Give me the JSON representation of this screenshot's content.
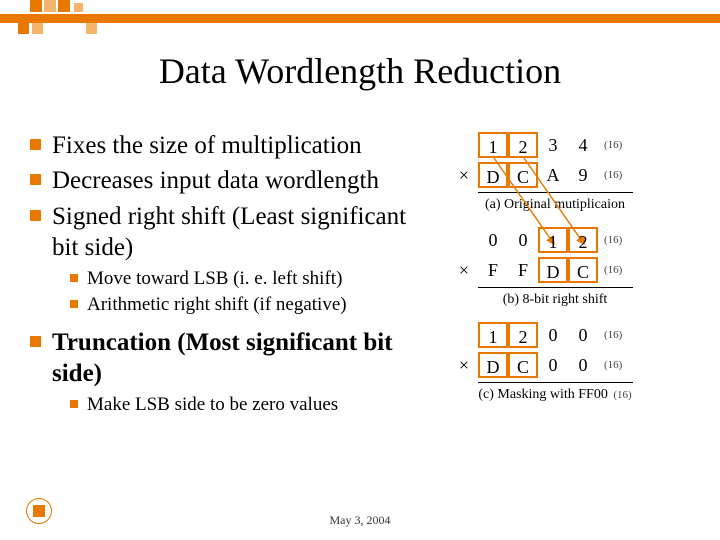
{
  "title": "Data Wordlength Reduction",
  "bullets": {
    "b1": "Fixes the size of multiplication",
    "b2": "Decreases input data wordlength",
    "b3": "Signed right shift (Least significant bit side)",
    "b3_sub": {
      "a": "Move toward LSB (i. e. left shift)",
      "b": "Arithmetic right shift (if negative)"
    },
    "b4": "Truncation (Most significant bit side)",
    "b4_sub": {
      "a": "Make LSB side to be zero values"
    }
  },
  "diagram": {
    "r1": {
      "a": "1",
      "b": "2",
      "c": "3",
      "d": "4",
      "sub": "(16)"
    },
    "r2": {
      "a": "D",
      "b": "C",
      "c": "A",
      "d": "9",
      "sub": "(16)"
    },
    "cap_a": "(a) Original mutiplicaion",
    "r3": {
      "a": "0",
      "b": "0",
      "c": "1",
      "d": "2",
      "sub": "(16)"
    },
    "r4": {
      "a": "F",
      "b": "F",
      "c": "D",
      "d": "C",
      "sub": "(16)"
    },
    "cap_b": "(b) 8-bit right shift",
    "r5": {
      "a": "1",
      "b": "2",
      "c": "0",
      "d": "0",
      "sub": "(16)"
    },
    "r6": {
      "a": "D",
      "b": "C",
      "c": "0",
      "d": "0",
      "sub": "(16)"
    },
    "cap_c": "(c) Masking with FF00",
    "cap_c_sub": "(16)",
    "mult": "×"
  },
  "footer": {
    "date": "May 3, 2004"
  }
}
